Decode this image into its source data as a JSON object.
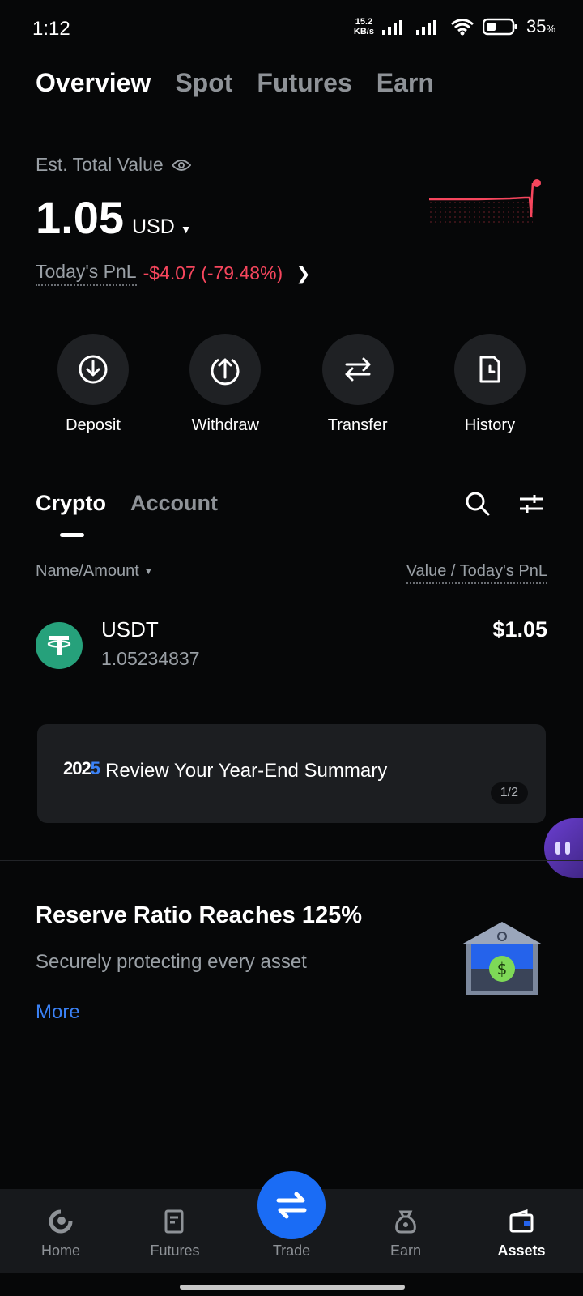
{
  "status_bar": {
    "time": "1:12",
    "net_speed_value": "15.2",
    "net_speed_unit": "KB/s",
    "battery": "35",
    "battery_unit": "%"
  },
  "top_tabs": [
    "Overview",
    "Spot",
    "Futures",
    "Earn"
  ],
  "total": {
    "label": "Est. Total Value",
    "value": "1.05",
    "currency": "USD",
    "pnl_label": "Today's PnL",
    "pnl_value": "-$4.07 (-79.48%)"
  },
  "actions": [
    {
      "label": "Deposit",
      "icon": "deposit-icon"
    },
    {
      "label": "Withdraw",
      "icon": "withdraw-icon"
    },
    {
      "label": "Transfer",
      "icon": "transfer-icon"
    },
    {
      "label": "History",
      "icon": "history-icon"
    }
  ],
  "section_tabs": [
    "Crypto",
    "Account"
  ],
  "columns": {
    "left": "Name/Amount",
    "right": "Value / Today's PnL"
  },
  "asset": {
    "symbol": "USDT",
    "amount": "1.05234837",
    "value": "$1.05"
  },
  "summary": {
    "logo_text_a": "202",
    "logo_text_b": "5",
    "text": "Review Your Year-End Summary",
    "page": "1/2"
  },
  "reserve": {
    "title": "Reserve Ratio Reaches 125%",
    "subtitle": "Securely protecting every asset",
    "more": "More"
  },
  "bottom_nav": [
    {
      "label": "Home",
      "icon": "home-icon"
    },
    {
      "label": "Futures",
      "icon": "futures-icon"
    },
    {
      "label": "Trade",
      "icon": "trade-icon"
    },
    {
      "label": "Earn",
      "icon": "earn-icon"
    },
    {
      "label": "Assets",
      "icon": "assets-icon"
    }
  ],
  "colors": {
    "background": "#060708",
    "negative": "#f6465d",
    "accent": "#3b82f6",
    "trade_button": "#1a6cf5",
    "usdt_green": "#26a17b"
  }
}
